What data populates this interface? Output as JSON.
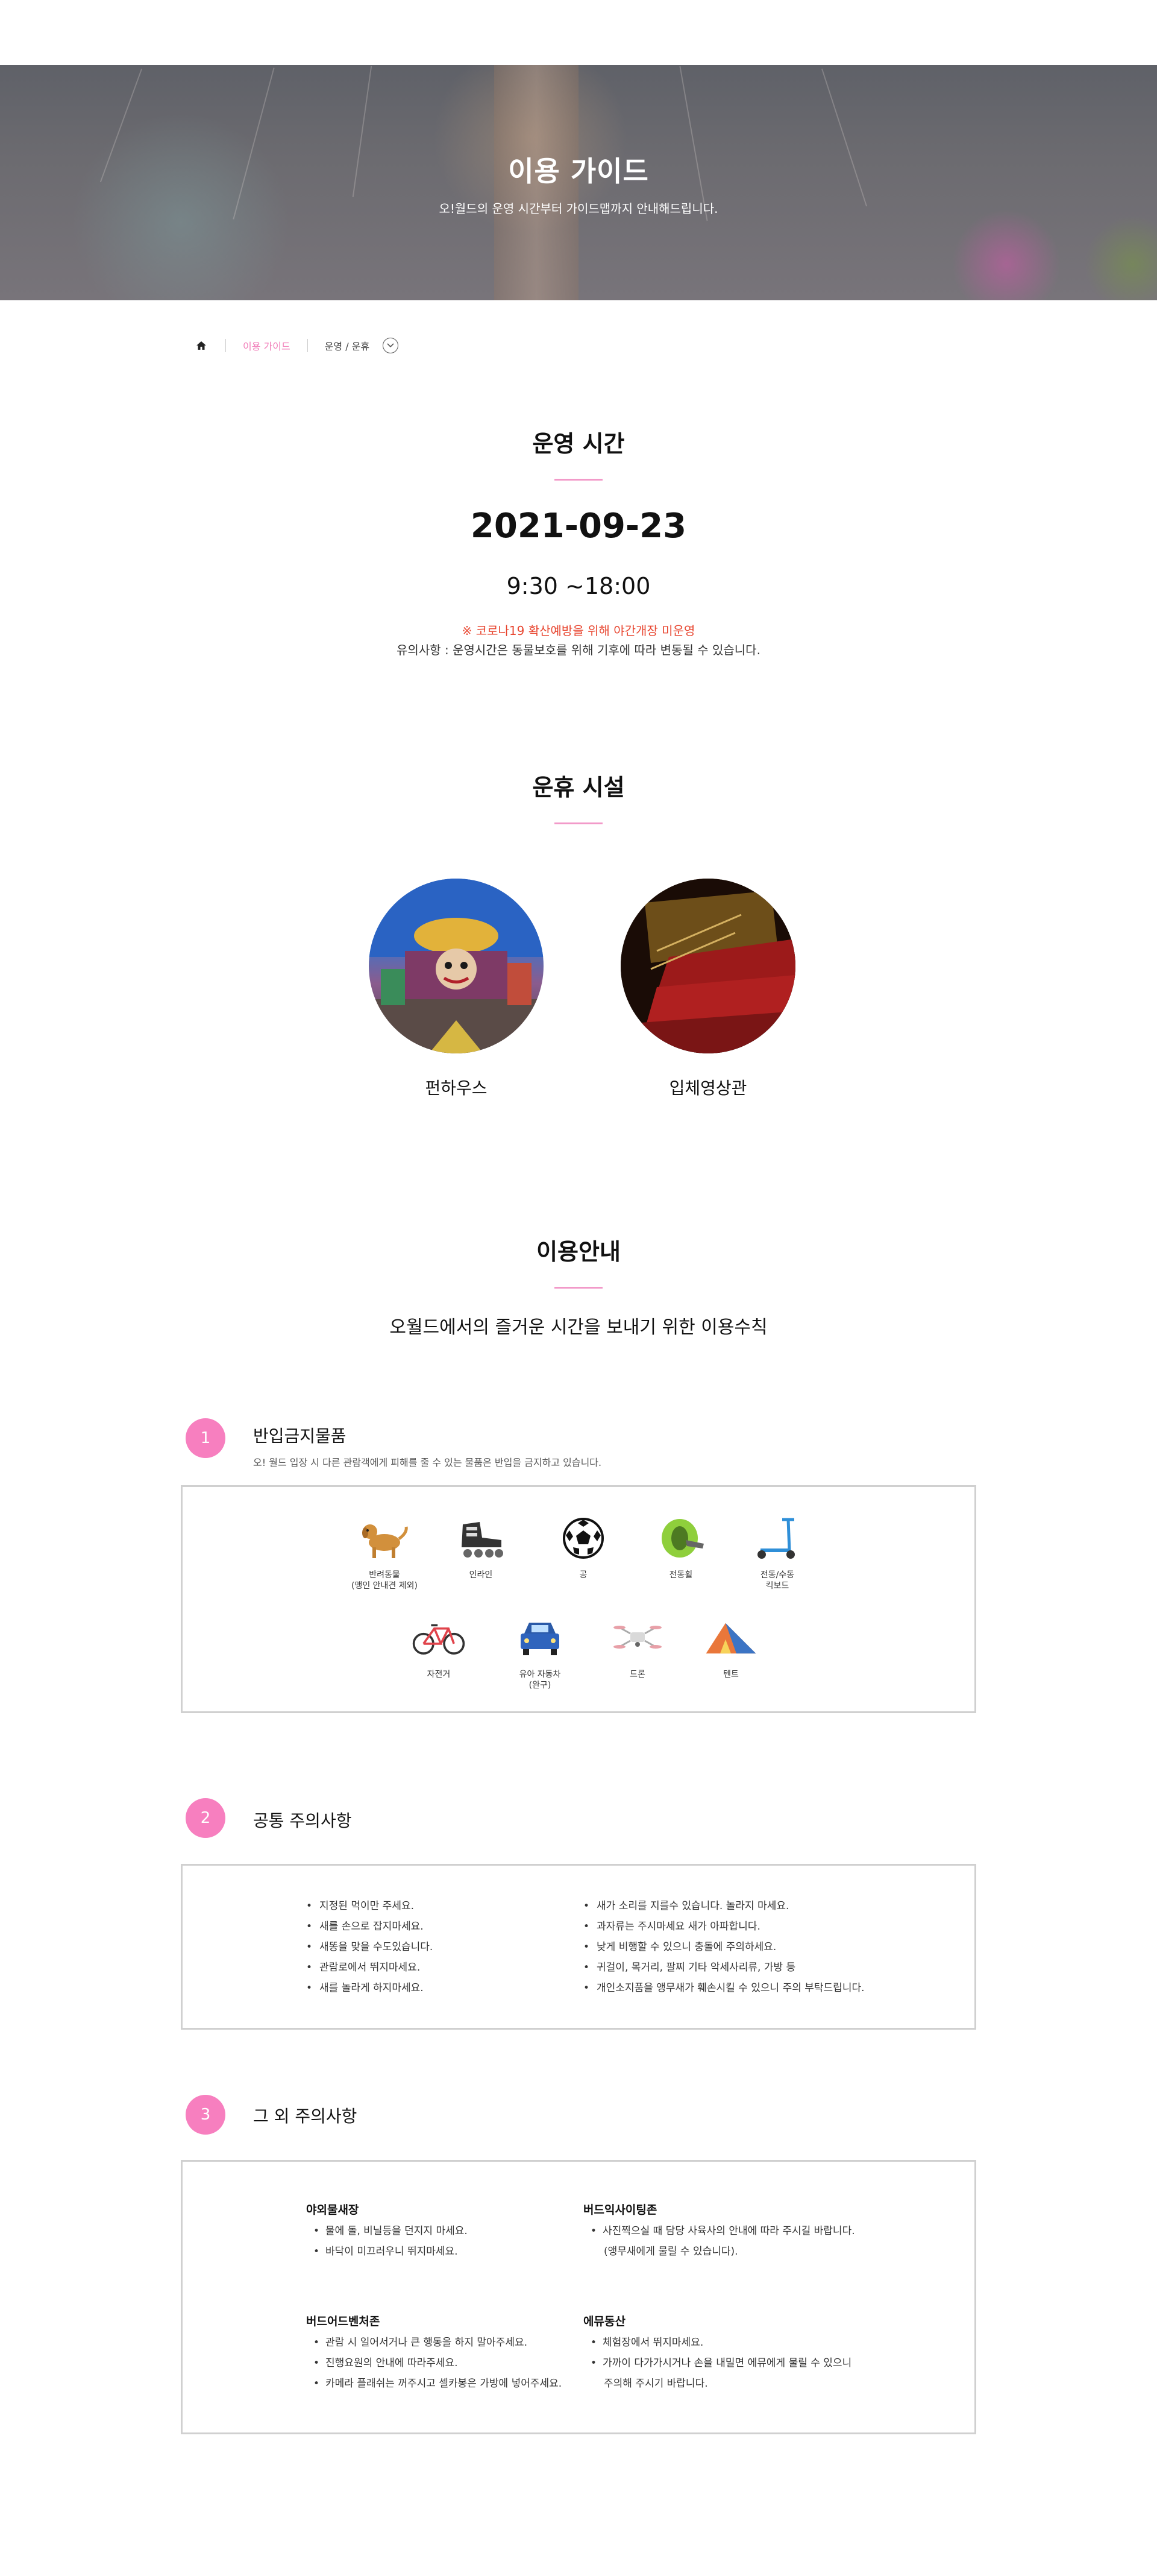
{
  "hero": {
    "title": "이용 가이드",
    "subtitle": "오!월드의 운영 시간부터 가이드맵까지 안내해드립니다."
  },
  "breadcrumb": {
    "current": "이용 가이드",
    "sub": "운영 / 운휴"
  },
  "operating": {
    "title": "운영 시간",
    "date": "2021-09-23",
    "hours": "9:30 ~18:00",
    "notice_red": "※ 코로나19 확산예방을 위해 야간개장 미운영",
    "notice": "유의사항 : 운영시간은 동물보호를 위해 기후에 따라 변동될 수 있습니다."
  },
  "facilities": {
    "title": "운휴 시설",
    "items": [
      {
        "name": "펀하우스"
      },
      {
        "name": "입체영상관"
      }
    ]
  },
  "guide": {
    "title": "이용안내",
    "description": "오월드에서의 즐거운 시간을 보내기 위한 이용수칙"
  },
  "section1": {
    "number": "1",
    "title": "반입금지물품",
    "subtitle": "오! 월드 입장 시 다른 관람객에게 피해를 줄 수 있는 물품은 반입을 금지하고 있습니다.",
    "items": [
      {
        "label": "반려동물\n(맹인 안내견 제외)",
        "icon": "dog-icon"
      },
      {
        "label": "인라인",
        "icon": "inline-skate-icon"
      },
      {
        "label": "공",
        "icon": "soccer-ball-icon"
      },
      {
        "label": "전동휠",
        "icon": "electric-wheel-icon"
      },
      {
        "label": "전동/수동\n킥보드",
        "icon": "kickboard-icon"
      },
      {
        "label": "자전거",
        "icon": "bicycle-icon"
      },
      {
        "label": "유아 자동차\n(완구)",
        "icon": "toy-car-icon"
      },
      {
        "label": "드론",
        "icon": "drone-icon"
      },
      {
        "label": "텐트",
        "icon": "tent-icon"
      }
    ]
  },
  "section2": {
    "number": "2",
    "title": "공통 주의사항",
    "left": [
      "지정된 먹이만 주세요.",
      "새를 손으로 잡지마세요.",
      "새똥을 맞을 수도있습니다.",
      "관람로에서 뛰지마세요.",
      "새를 놀라게 하지마세요."
    ],
    "right": [
      "새가 소리를 지를수 있습니다. 놀라지 마세요.",
      "과자류는 주시마세요 새가 아파합니다.",
      "낮게 비행할 수 있으니 충돌에 주의하세요.",
      "귀걸이, 목거리, 팔찌 기타 악세사리류, 가방 등",
      "개인소지품을 앵무새가 훼손시킬 수 있으니 주의 부탁드립니다."
    ]
  },
  "section3": {
    "number": "3",
    "title": "그 외 주의사항",
    "blocks": [
      {
        "heading": "야외물새장",
        "items": [
          "물에 돌, 비닐등을 던지지 마세요.",
          "바닥이 미끄러우니 뛰지마세요."
        ],
        "cont": ""
      },
      {
        "heading": "버드익사이팅존",
        "items": [
          "사진찍으실 때 담당 사육사의 안내에 따라 주시길 바랍니다."
        ],
        "cont": "(앵무새에게 물릴 수 있습니다)."
      },
      {
        "heading": "버드어드벤처존",
        "items": [
          "관람 시 일어서거나 큰 행동을 하지 말아주세요.",
          "진행요원의 안내에 따라주세요.",
          "카메라 플래쉬는 꺼주시고 셀카봉은 가방에 넣어주세요."
        ],
        "cont": ""
      },
      {
        "heading": "에뮤동산",
        "items": [
          "체험장에서 뛰지마세요.",
          "가까이 다가가시거나 손을 내밀면 에뮤에게 물릴 수 있으니"
        ],
        "cont": "주의해 주시기 바랍니다."
      }
    ]
  }
}
